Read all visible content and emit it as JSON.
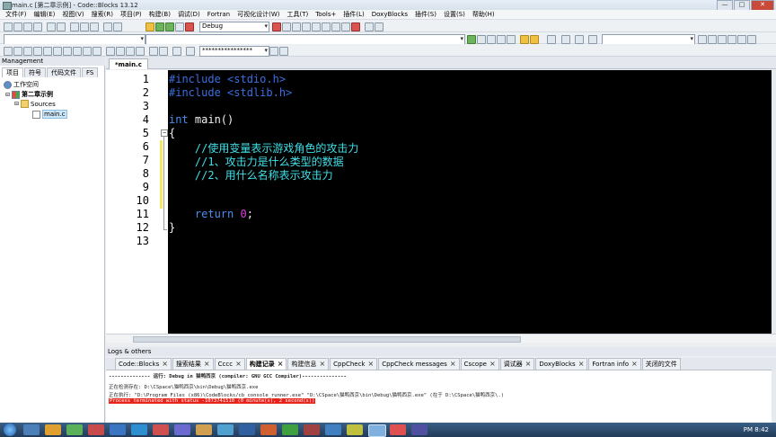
{
  "window": {
    "title": "main.c [第二章示例] - Code::Blocks 13.12",
    "buttons": {
      "minimize": "—",
      "maximize": "□",
      "close": "✕"
    }
  },
  "menu": [
    "文件(F)",
    "编辑(E)",
    "视图(V)",
    "搜索(R)",
    "项目(P)",
    "构建(B)",
    "调试(D)",
    "Fortran",
    "可视化设计(W)",
    "工具(T)",
    "Tools+",
    "插件(L)",
    "DoxyBlocks",
    "插件(S)",
    "设置(S)",
    "帮助(H)"
  ],
  "toolbar": {
    "build_target": "Debug",
    "search_combo": "****************"
  },
  "management": {
    "title": "Management",
    "tabs": [
      "项目",
      "符号",
      "代码文件",
      "FS"
    ],
    "tree": {
      "workspace": "工作空间",
      "project": "第二章示例",
      "folder": "Sources",
      "file": "main.c"
    }
  },
  "editor": {
    "tab": "*main.c",
    "line_numbers": [
      "1",
      "2",
      "3",
      "4",
      "5",
      "6",
      "7",
      "8",
      "9",
      "10",
      "11",
      "12",
      "13"
    ],
    "code": {
      "l1": "#include <stdio.h>",
      "l2": "#include <stdlib.h>",
      "l4a": "int",
      "l4b": " main()",
      "l5": "{",
      "l6": "    //使用变量表示游戏角色的攻击力",
      "l7": "    //1、攻击力是什么类型的数据",
      "l8": "    //2、用什么名称表示攻击力",
      "l11a": "    return ",
      "l11b": "0",
      "l11c": ";",
      "l12": "}"
    }
  },
  "logs": {
    "title": "Logs & others",
    "tabs": [
      "Code::Blocks",
      "搜索结果",
      "Cccc",
      "构建记录",
      "构建信息",
      "CppCheck",
      "CppCheck messages",
      "Cscope",
      "调试器",
      "DoxyBlocks",
      "Fortran info",
      "关闭的文件"
    ],
    "active_tab": "构建记录",
    "lines": [
      "-------------- 运行: Debug in 猫鸭西京 (compiler: GNU GCC Compiler)---------------",
      "正在检测存在:  D:\\CSpace\\猫鸭西京\\bin\\Debug\\猫鸭西京.exe",
      "正在执行: \"D:\\Program Files (x86)\\CodeBlocks/cb_console_runner.exe\" \"D:\\CSpace\\猫鸭西京\\bin\\Debug\\猫鸭西京.exe\"  (在于 D:\\CSpace\\猫鸭西京\\.)",
      "Process terminated with status -1073741510 (0 minute(s), 2 second(s))"
    ]
  },
  "taskbar": {
    "clock": "PM 8:42"
  },
  "colors": {
    "editor_bg": "#000000",
    "keyword": "#4a8ff0",
    "comment": "#40e0e8",
    "number": "#e040e0",
    "error_bg": "#e8251b"
  }
}
